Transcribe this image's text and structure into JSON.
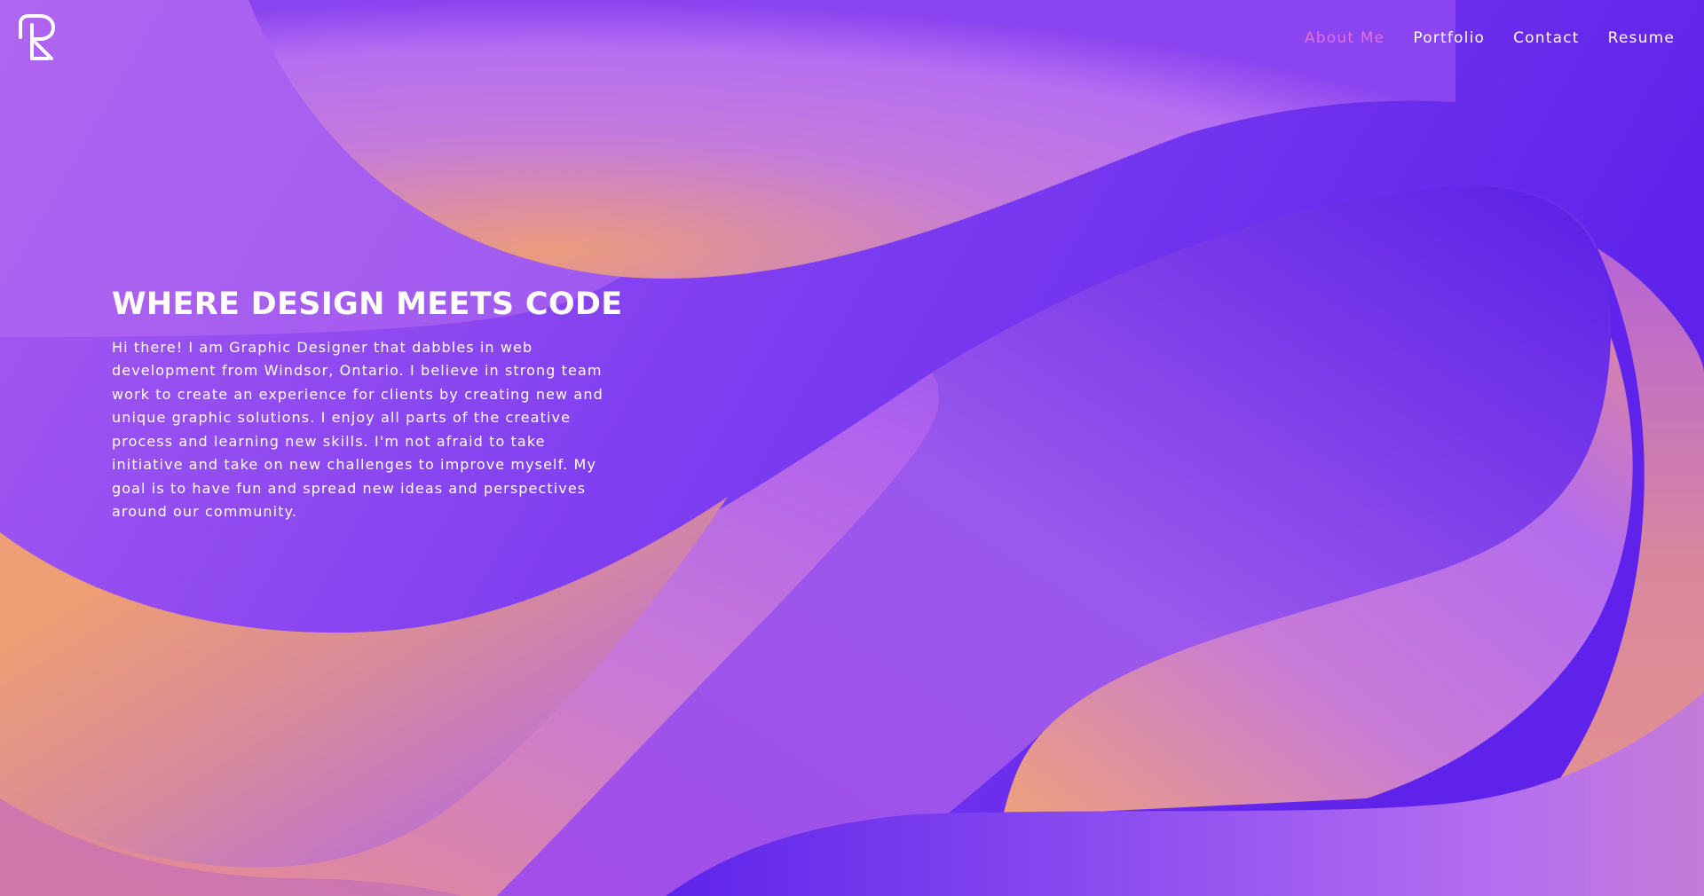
{
  "header": {
    "logo_icon": "monogram-rl-logo",
    "nav": [
      {
        "label": "About Me",
        "active": true
      },
      {
        "label": "Portfolio",
        "active": false
      },
      {
        "label": "Contact",
        "active": false
      },
      {
        "label": "Resume",
        "active": false
      }
    ]
  },
  "hero": {
    "title": "WHERE DESIGN MEETS CODE",
    "body": "Hi there! I am Graphic Designer that dabbles in web development from Windsor, Ontario. I believe in strong team work to create an experience for clients by creating new and unique graphic solutions. I enjoy all parts of the creative process and learning new skills. I'm not afraid to take initiative and take on new challenges to improve myself. My goal is to have fun and spread new ideas and perspectives around our community."
  },
  "colors": {
    "nav_active": "#e46fd9",
    "text": "#ffffff",
    "violet_deep": "#5a20e8",
    "violet_mid": "#9b55ec",
    "lilac": "#c07ae6",
    "peach": "#ee9d72"
  }
}
